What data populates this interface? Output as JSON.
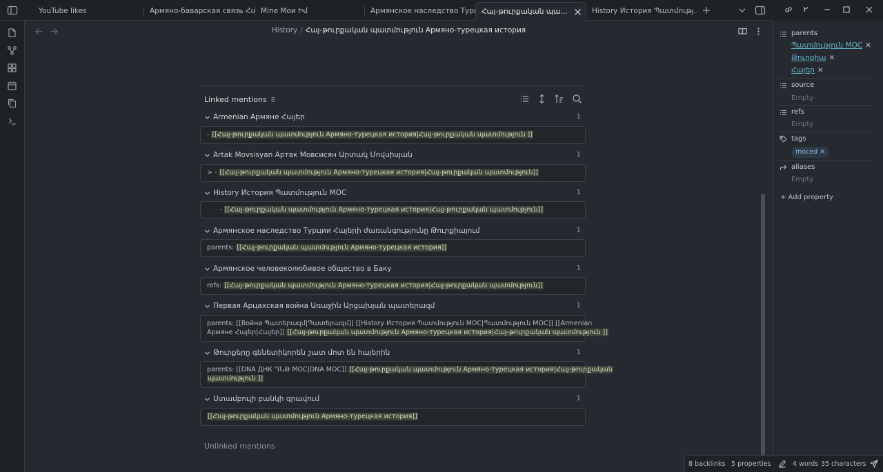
{
  "tabs": [
    {
      "label": "YouTube likes"
    },
    {
      "label": "Армяно-баварская связь Հայ..."
    },
    {
      "label": "Mine Мои Իմ"
    },
    {
      "label": "Армянское наследство Турции..."
    },
    {
      "label": "Հայ-թուրքական պա..."
    },
    {
      "label": "History История Պատմությ..."
    }
  ],
  "breadcrumb": {
    "parent": "History",
    "separator": "/",
    "current": "Հայ-թուրքական պատմություն Армяно-турецкая история"
  },
  "linked_mentions": {
    "title": "Linked mentions",
    "count": "8",
    "groups": [
      {
        "title": "Armenian Армяне Հայեր",
        "count": "1",
        "lines": [
          [
            {
              "t": "- ",
              "h": false
            },
            {
              "t": "[[Հայ-թուրքական պատմություն Армяно-турецкая история|Հայ-թուրքական պատմություն ]]",
              "h": true
            }
          ]
        ]
      },
      {
        "title": "Artak Movsisyan Артак Мовсисян Արտակ Մովսիսյան",
        "count": "1",
        "lines": [
          [
            {
              "t": "> - ",
              "h": false
            },
            {
              "t": "[[Հայ-թուրքական պատմություն Армяно-турецкая история|Հայ-թուրքական պատմություն]]",
              "h": true
            }
          ]
        ]
      },
      {
        "title": "History История Պատմություն MOC",
        "count": "1",
        "lines": [
          [
            {
              "t": "      - ",
              "h": false
            },
            {
              "t": "[[Հայ-թուրքական պատմություն Армяно-турецкая история|Հայ-թուրքական պատմություն]]",
              "h": true
            }
          ]
        ]
      },
      {
        "title": "Армянское наследство Турции Հայերի ժառանգությունը Թուրքիայում",
        "count": "1",
        "lines": [
          [
            {
              "t": "parents: ",
              "h": false
            },
            {
              "t": "[[Հայ-թուրքական պատմություն Армяно-турецкая история]]",
              "h": true
            }
          ]
        ]
      },
      {
        "title": "Армянское человеколюбивое общество в Баку",
        "count": "1",
        "lines": [
          [
            {
              "t": "refs: ",
              "h": false
            },
            {
              "t": "[[Հայ-թուրքական պատմություն Армяно-турецкая история|Հայ-թուրքական պատմություն]]",
              "h": true
            }
          ]
        ]
      },
      {
        "title": "Первая Арцахская война Առաջին Արցախյան պատերազմ",
        "count": "1",
        "lines": [
          [
            {
              "t": "parents: [[Война Պատերազմ|Պատերազմ]] [[History История Պատմություն MOC|Պատմություն MOC]] [[Armenian",
              "h": false
            }
          ],
          [
            {
              "t": "Армяне Հայեր|Հայեր]] ",
              "h": false
            },
            {
              "t": "[[Հայ-թուրքական պատմություն Армяно-турецкая история|Հայ-թուրքական պատմություն ]]",
              "h": true
            }
          ]
        ]
      },
      {
        "title": "Թուրքերը գենետիկորեն շատ մոտ են հայերին",
        "count": "1",
        "lines": [
          [
            {
              "t": "parents: [[DNA ДНК ԴՆԹ MOC|DNA MOC]] ",
              "h": false
            },
            {
              "t": "[[Հայ-թուրքական պատմություն Армяно-турецкая история|Հայ-թուրքական",
              "h": true
            }
          ],
          [
            {
              "t": "պատմություն ]]",
              "h": true
            }
          ]
        ]
      },
      {
        "title": "Ստամբուլի բանկի գրավում",
        "count": "1",
        "lines": [
          [
            {
              "t": "[[Հայ-թուրքական պատմություն Армяно-турецкая история]]",
              "h": true
            }
          ]
        ]
      }
    ]
  },
  "unlinked_mentions": {
    "title": "Unlinked mentions"
  },
  "properties": {
    "parents": {
      "label": "parents",
      "values": [
        "Պատմություն MOC",
        "Թուրքիա",
        "Հայեր"
      ],
      "remove_glyph": "✕"
    },
    "source": {
      "label": "source",
      "value": "Empty"
    },
    "refs": {
      "label": "refs",
      "value": "Empty"
    },
    "tags": {
      "label": "tags",
      "value": "moced",
      "remove_glyph": "✕"
    },
    "aliases": {
      "label": "aliases",
      "value": "Empty"
    },
    "add_label": "+ Add property"
  },
  "status": {
    "backlinks": "8 backlinks",
    "properties": "5 properties",
    "words": "4 words",
    "characters": "35 characters"
  },
  "icons": {
    "sidebar_toggle": "sidebar-toggle-icon",
    "new_tab": "plus-icon",
    "tab_list": "chevron-down-icon",
    "right_sidebar": "right-sidebar-icon",
    "ribbon": [
      "file-icon",
      "graph-icon",
      "canvas-icon",
      "calendar-icon",
      "copy-icon",
      "terminal-icon"
    ],
    "reading_view": "book-open-icon",
    "more": "more-vertical-icon"
  }
}
